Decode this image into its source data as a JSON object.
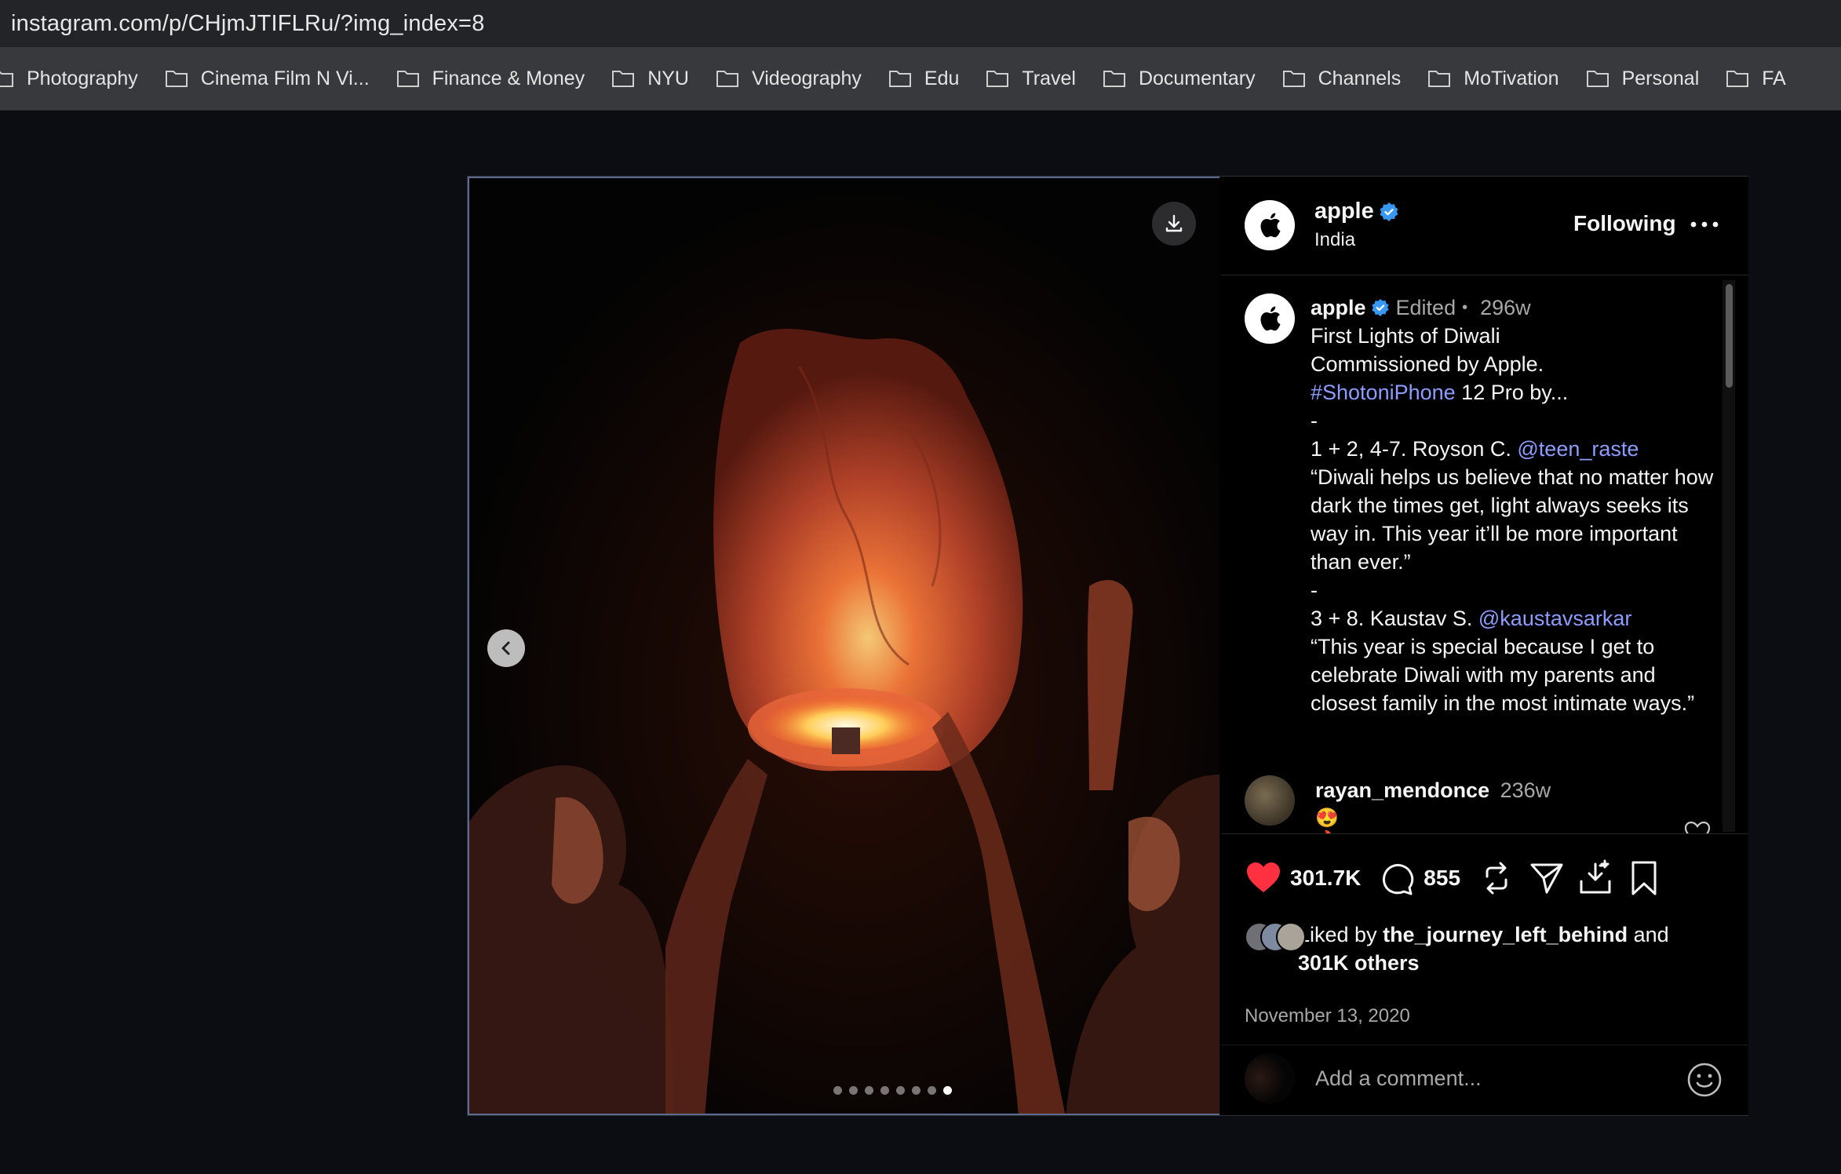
{
  "browser": {
    "url": "instagram.com/p/CHjmJTIFLRu/?img_index=8",
    "bookmarks": [
      "Photography",
      "Cinema Film N Vi...",
      "Finance & Money",
      "NYU",
      "Videography",
      "Edu",
      "Travel",
      "Documentary",
      "Channels",
      "MoTivation",
      "Personal",
      "FA"
    ]
  },
  "post": {
    "carousel": {
      "total": 8,
      "active_index": 8
    },
    "header": {
      "username": "apple",
      "location": "India",
      "follow_label": "Following"
    },
    "caption": {
      "username": "apple",
      "edited": "Edited",
      "separator": "•",
      "age": "296w",
      "line1": "First Lights of Diwali",
      "line2": "Commissioned by Apple.",
      "hashtag": "#ShotoniPhone",
      "line3_rest": " 12 Pro by...",
      "dash1": "-",
      "credit1_prefix": "1 + 2, 4-7. Royson C. ",
      "credit1_handle": "@teen_raste",
      "quote1": "“Diwali helps us believe that no matter how dark the times get, light always seeks its way in. This year it’ll be more important than ever.”",
      "dash2": "-",
      "credit2_prefix": "3 + 8. Kaustav S. ",
      "credit2_handle": "@kaustavsarkar",
      "quote2": "“This year is special because I get to celebrate Diwali with my parents and closest family in the most intimate ways.”"
    },
    "comments": [
      {
        "username": "rayan_mendonce",
        "age": "236w",
        "text": "😍🔥🔥"
      }
    ],
    "actions": {
      "likes": "301.7K",
      "comments": "855"
    },
    "liked_by": {
      "prefix": "Liked by ",
      "user": "the_journey_left_behind",
      "middle": " and ",
      "others": "301K others"
    },
    "date": "November 13, 2020",
    "add_comment_placeholder": "Add a comment..."
  },
  "colors": {
    "link": "#8d9cff",
    "like_red": "#ff3040",
    "verified": "#3897f0"
  },
  "icons": [
    "download-icon",
    "chevron-left-icon",
    "verified-badge-icon",
    "more-options-icon",
    "heart-filled-icon",
    "comment-icon",
    "repost-icon",
    "share-icon",
    "save-to-collection-icon",
    "bookmark-icon",
    "emoji-icon",
    "folder-icon"
  ]
}
